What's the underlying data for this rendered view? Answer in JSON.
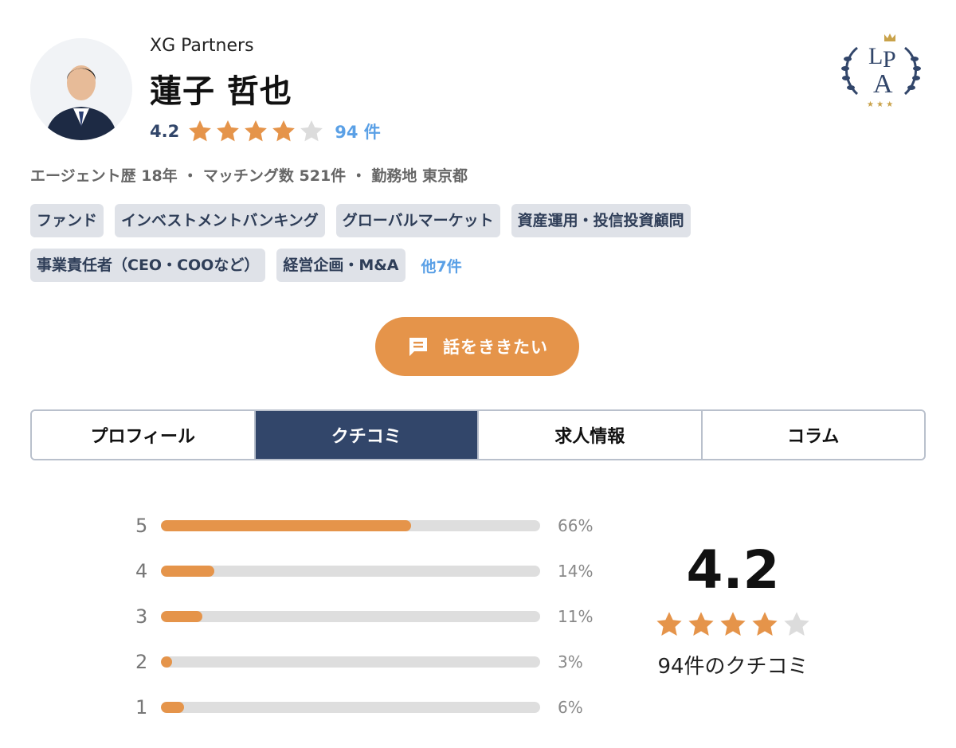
{
  "agent": {
    "company": "XG Partners",
    "name": "蓮子 哲也",
    "rating": "4.2",
    "rating_value": 4.2,
    "review_count_label": "94 件",
    "meta": "エージェント歴 18年 ・ マッチング数 521件 ・ 勤務地 東京都",
    "logo_text": "LPA"
  },
  "tags": {
    "row1": [
      "ファンド",
      "インベストメントバンキング",
      "グローバルマーケット",
      "資産運用・投信投資顧問"
    ],
    "row2": [
      "事業責任者（CEO・COOなど）",
      "経営企画・M&A"
    ],
    "more": "他7件"
  },
  "cta": {
    "label": "話をききたい",
    "icon": "chat-icon"
  },
  "tabs": [
    {
      "label": "プロフィール",
      "active": false
    },
    {
      "label": "クチコミ",
      "active": true
    },
    {
      "label": "求人情報",
      "active": false
    },
    {
      "label": "コラム",
      "active": false
    }
  ],
  "ratings": {
    "distribution": [
      {
        "stars": "5",
        "percent": 66,
        "label": "66%"
      },
      {
        "stars": "4",
        "percent": 14,
        "label": "14%"
      },
      {
        "stars": "3",
        "percent": 11,
        "label": "11%"
      },
      {
        "stars": "2",
        "percent": 3,
        "label": "3%"
      },
      {
        "stars": "1",
        "percent": 6,
        "label": "6%"
      }
    ],
    "score": "4.2",
    "count_label": "94件のクチコミ"
  },
  "colors": {
    "accent": "#e5944a",
    "navy": "#32466a",
    "link": "#5aa0e6",
    "star_empty": "#dcdcdc"
  }
}
